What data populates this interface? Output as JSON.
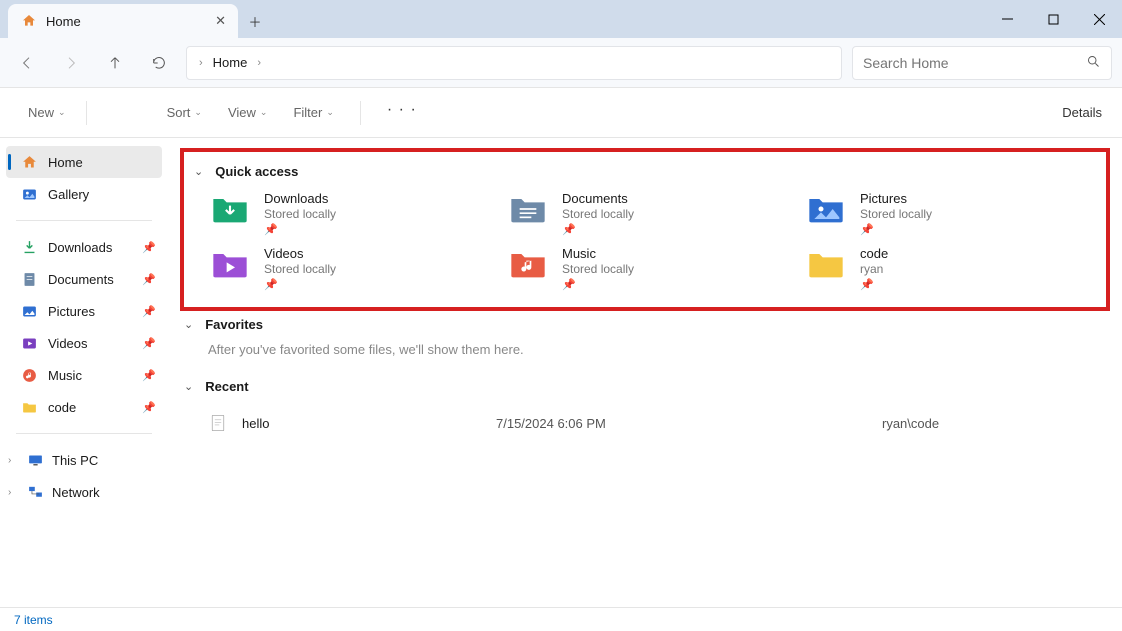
{
  "window": {
    "tab_title": "Home"
  },
  "addressbar": {
    "location": "Home"
  },
  "search": {
    "placeholder": "Search Home"
  },
  "toolbar": {
    "new": "New",
    "sort": "Sort",
    "view": "View",
    "filter": "Filter",
    "details": "Details"
  },
  "sidebar": {
    "home": "Home",
    "gallery": "Gallery",
    "quick": [
      {
        "label": "Downloads"
      },
      {
        "label": "Documents"
      },
      {
        "label": "Pictures"
      },
      {
        "label": "Videos"
      },
      {
        "label": "Music"
      },
      {
        "label": "code"
      }
    ],
    "this_pc": "This PC",
    "network": "Network"
  },
  "sections": {
    "quick_access": {
      "title": "Quick access",
      "items": [
        {
          "name": "Downloads",
          "sub": "Stored locally"
        },
        {
          "name": "Documents",
          "sub": "Stored locally"
        },
        {
          "name": "Pictures",
          "sub": "Stored locally"
        },
        {
          "name": "Videos",
          "sub": "Stored locally"
        },
        {
          "name": "Music",
          "sub": "Stored locally"
        },
        {
          "name": "code",
          "sub": "ryan"
        }
      ]
    },
    "favorites": {
      "title": "Favorites",
      "empty_text": "After you've favorited some files, we'll show them here."
    },
    "recent": {
      "title": "Recent",
      "items": [
        {
          "name": "hello",
          "date": "7/15/2024 6:06 PM",
          "path": "ryan\\code"
        }
      ]
    }
  },
  "statusbar": {
    "count_text": "7 items"
  }
}
